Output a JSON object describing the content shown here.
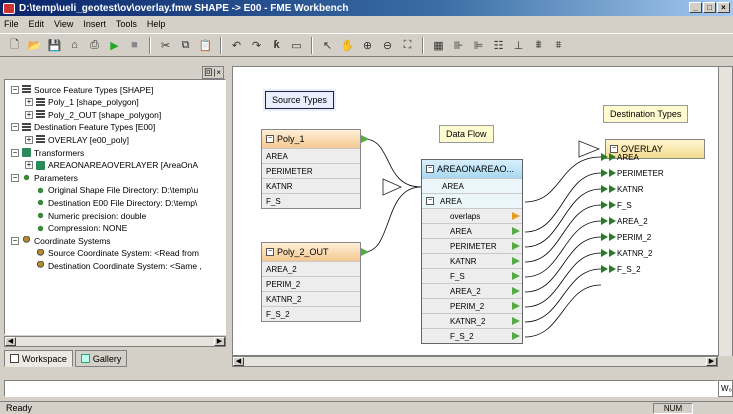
{
  "window": {
    "title": "D:\\temp\\ueli_geotest\\ov\\overlay.fmw  SHAPE -> E00 - FME Workbench",
    "buttons": [
      "_",
      "□",
      "×"
    ]
  },
  "menu": [
    "File",
    "Edit",
    "View",
    "Insert",
    "Tools",
    "Help"
  ],
  "toolbar_icons": [
    "new-icon",
    "open-icon",
    "save-icon",
    "undo-icon",
    "print-icon",
    "run-icon",
    "stop-icon",
    "cut-icon",
    "copy-icon",
    "paste-icon",
    "undo2-icon",
    "redo-icon",
    "transformer-icon",
    "annotation-icon",
    "pointer-icon",
    "pan-icon",
    "zoom-in-icon",
    "zoom-out-icon",
    "fit-icon",
    "layout-icon",
    "align1-icon",
    "align2-icon",
    "align3-icon",
    "align4-icon",
    "align5-icon",
    "align6-icon"
  ],
  "left_panel": {
    "mini_buttons": "回|×",
    "tree": [
      {
        "label": "Source Feature Types [SHAPE]",
        "level": 0,
        "icon": "feature",
        "expand": "−"
      },
      {
        "label": "Poly_1 [shape_polygon]",
        "level": 1,
        "icon": "feature",
        "expand": "+"
      },
      {
        "label": "Poly_2_OUT [shape_polygon]",
        "level": 1,
        "icon": "feature",
        "expand": "+"
      },
      {
        "label": "Destination Feature Types [E00]",
        "level": 0,
        "icon": "feature",
        "expand": "−"
      },
      {
        "label": "OVERLAY [e00_poly]",
        "level": 1,
        "icon": "feature",
        "expand": "+"
      },
      {
        "label": "Transformers",
        "level": 0,
        "icon": "transformer",
        "expand": "−"
      },
      {
        "label": "AREAONAREAOVERLAYER [AreaOnA",
        "level": 1,
        "icon": "transformer",
        "expand": "+"
      },
      {
        "label": "Parameters",
        "level": 0,
        "icon": "param",
        "expand": "−"
      },
      {
        "label": "Original Shape File Directory: D:\\temp\\u",
        "level": 1,
        "icon": "param",
        "expand": ""
      },
      {
        "label": "Destination E00 File Directory: D:\\temp\\",
        "level": 1,
        "icon": "param",
        "expand": ""
      },
      {
        "label": "Numeric precision: double",
        "level": 1,
        "icon": "param",
        "expand": ""
      },
      {
        "label": "Compression: NONE",
        "level": 1,
        "icon": "param",
        "expand": ""
      },
      {
        "label": "Coordinate Systems",
        "level": 0,
        "icon": "coord",
        "expand": "−"
      },
      {
        "label": "Source Coordinate System: <Read from",
        "level": 1,
        "icon": "coord",
        "expand": ""
      },
      {
        "label": "Destination Coordinate System: <Same ,",
        "level": 1,
        "icon": "coord",
        "expand": ""
      }
    ],
    "tabs": [
      "Workspace",
      "Gallery"
    ]
  },
  "canvas": {
    "annotations": {
      "source": "Source Types",
      "flow": "Data Flow",
      "dest": "Destination Types"
    },
    "poly1": {
      "title": "Poly_1",
      "attrs": [
        "AREA",
        "PERIMETER",
        "KATNR",
        "F_S"
      ]
    },
    "poly2": {
      "title": "Poly_2_OUT",
      "attrs": [
        "AREA_2",
        "PERIM_2",
        "KATNR_2",
        "F_S_2"
      ]
    },
    "transformer": {
      "title": "AREAONAREAO...",
      "in_ports": [
        "AREA",
        "AREA"
      ],
      "attrs": [
        "overlaps",
        "AREA",
        "PERIMETER",
        "KATNR",
        "F_S",
        "AREA_2",
        "PERIM_2",
        "KATNR_2",
        "F_S_2"
      ]
    },
    "overlay": {
      "title": "OVERLAY",
      "attrs": [
        "AREA",
        "PERIMETER",
        "KATNR",
        "F_S",
        "AREA_2",
        "PERIM_2",
        "KATNR_2",
        "F_S_2"
      ]
    }
  },
  "log": {
    "label": "×",
    "side": "W₀"
  },
  "status": {
    "text": "Ready",
    "num": "NUM"
  }
}
